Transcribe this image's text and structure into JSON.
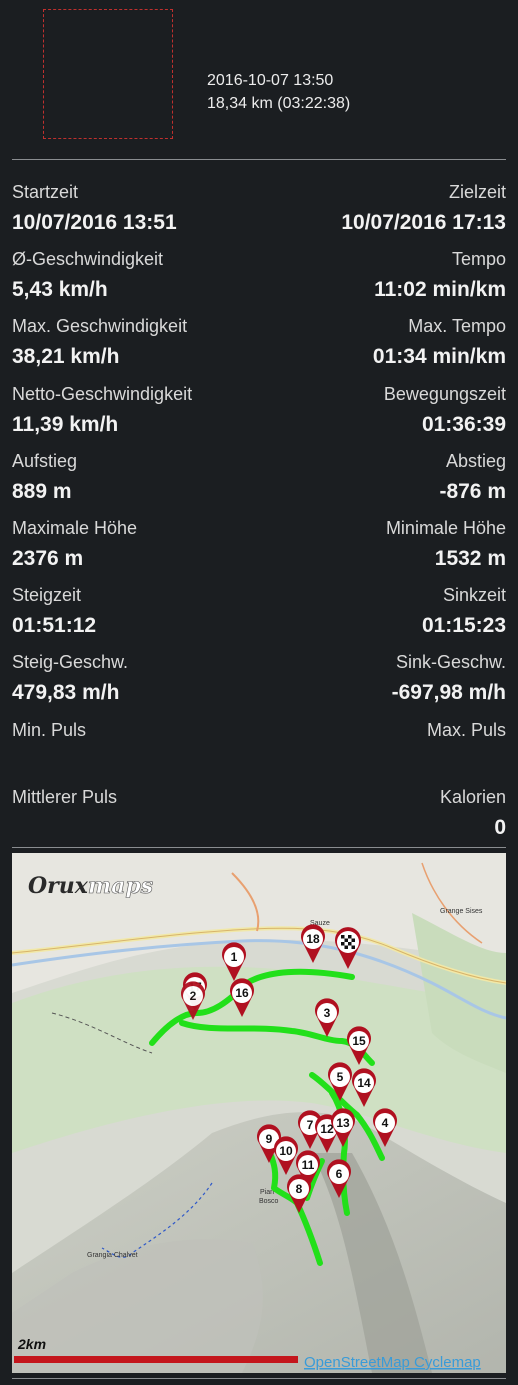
{
  "header": {
    "date_time": "2016-10-07 13:50",
    "distance_duration": "18,34 km (03:22:38)"
  },
  "stats": [
    {
      "left_label": "Startzeit",
      "left_value": "10/07/2016 13:51",
      "right_label": "Zielzeit",
      "right_value": "10/07/2016 17:13"
    },
    {
      "left_label": "Ø-Geschwindigkeit",
      "left_value": "5,43 km/h",
      "right_label": "Tempo",
      "right_value": "11:02 min/km"
    },
    {
      "left_label": "Max. Geschwindigkeit",
      "left_value": "38,21 km/h",
      "right_label": "Max. Tempo",
      "right_value": "01:34 min/km"
    },
    {
      "left_label": "Netto-Geschwindigkeit",
      "left_value": "11,39 km/h",
      "right_label": "Bewegungszeit",
      "right_value": "01:36:39"
    },
    {
      "left_label": "Aufstieg",
      "left_value": "889 m",
      "right_label": "Abstieg",
      "right_value": "-876 m"
    },
    {
      "left_label": "Maximale Höhe",
      "left_value": "2376 m",
      "right_label": "Minimale Höhe",
      "right_value": "1532 m"
    },
    {
      "left_label": "Steigzeit",
      "left_value": "01:51:12",
      "right_label": "Sinkzeit",
      "right_value": "01:15:23"
    },
    {
      "left_label": "Steig-Geschw.",
      "left_value": "479,83 m/h",
      "right_label": "Sink-Geschw.",
      "right_value": "-697,98 m/h"
    },
    {
      "left_label": "Min. Puls",
      "left_value": "",
      "right_label": "Max. Puls",
      "right_value": ""
    },
    {
      "left_label": "Mittlerer Puls",
      "left_value": "",
      "right_label": "Kalorien",
      "right_value": "0"
    }
  ],
  "map": {
    "logo_part1": "Orux",
    "logo_part2": "maps",
    "scale_label": "2km",
    "credit": "OpenStreetMap Cyclemap",
    "route_color": "#22e01a",
    "pin_color": "#b01020",
    "scale_bar_color": "#c4161c",
    "place_labels": [
      "Sauze",
      "Grange Sises",
      "Grangia Chalvet",
      "Bosco",
      "Pian"
    ],
    "pins": [
      "1",
      "2",
      "3",
      "4",
      "5",
      "6",
      "7",
      "8",
      "9",
      "10",
      "11",
      "12",
      "13",
      "14",
      "15",
      "16",
      "17",
      "18"
    ]
  }
}
